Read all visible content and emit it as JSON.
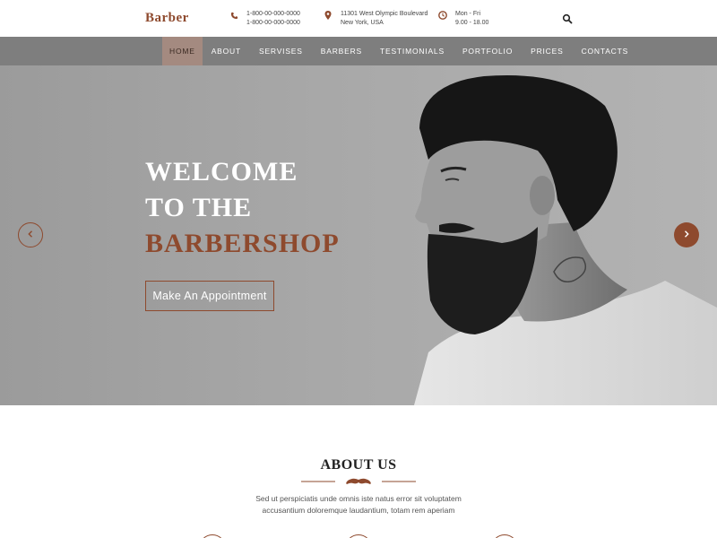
{
  "brand": {
    "name": "Barber",
    "accent": "#8e4a2e"
  },
  "contact": {
    "phone": {
      "icon": "phone-icon",
      "lines": [
        "1-800-00-000-0000",
        "1-800-00-000-0000"
      ]
    },
    "address": {
      "icon": "location-pin-icon",
      "lines": [
        "11301 West Olympic Boulevard",
        "New York, USA"
      ]
    },
    "hours": {
      "icon": "clock-icon",
      "lines": [
        "Mon - Fri",
        "9.00 - 18.00"
      ]
    },
    "search_icon": "search-icon"
  },
  "nav": {
    "items": [
      "HOME",
      "ABOUT",
      "SERVISES",
      "BARBERS",
      "TESTIMONIALS",
      "PORTFOLIO",
      "PRICES",
      "CONTACTS"
    ],
    "active": "HOME"
  },
  "hero": {
    "line1": "WELCOME",
    "line2": "TO THE",
    "line3": "BARBERSHOP",
    "button": "Make An Appointment",
    "prev_icon": "chevron-left-icon",
    "next_icon": "chevron-right-icon"
  },
  "about": {
    "title": "ABOUT US",
    "divider_icon": "mustache-icon",
    "text_line1": "Sed ut perspiciatis unde omnis iste natus error sit voluptatem",
    "text_line2": "accusantium doloremque laudantium, totam rem aperiam"
  }
}
